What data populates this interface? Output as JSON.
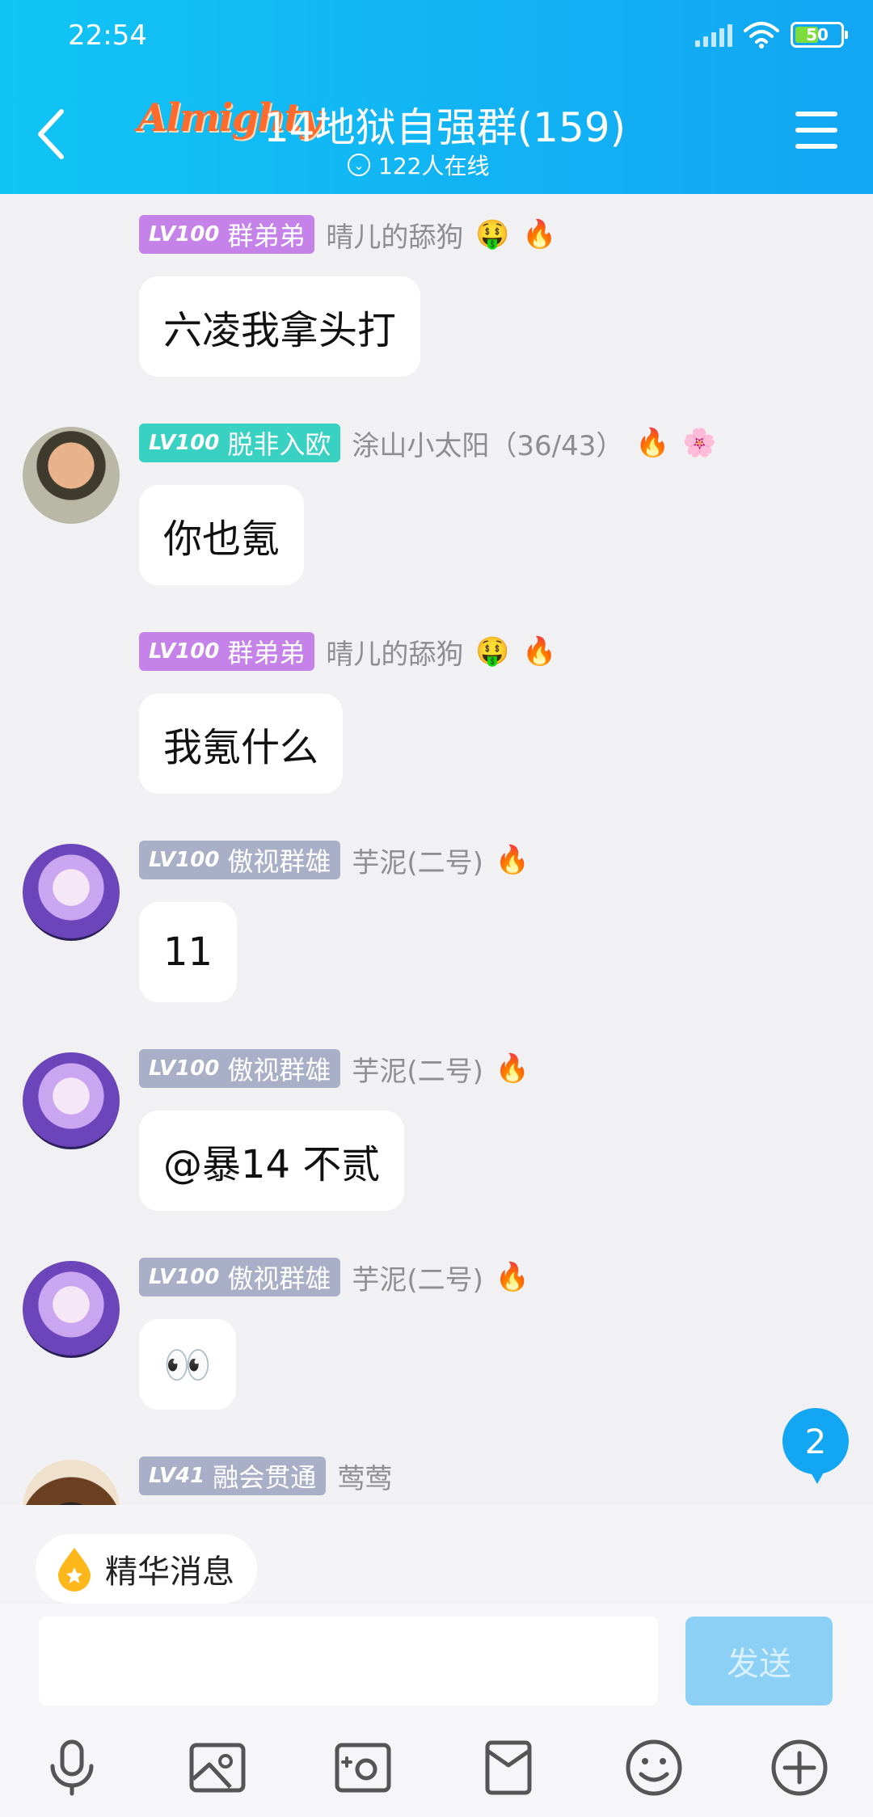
{
  "status_bar": {
    "time": "22:54",
    "battery": "50"
  },
  "header": {
    "logo_text": "Almighty",
    "title": "14地狱自强群(159)",
    "online": "122人在线"
  },
  "messages": [
    {
      "badge_level": "LV100",
      "badge_title": "群弟弟",
      "badge_color": "#c583ea",
      "sender": "晴儿的舔狗",
      "text": "六凌我拿头打",
      "has_avatar": false
    },
    {
      "badge_level": "LV100",
      "badge_title": "脱非入欧",
      "badge_color": "#38d1c2",
      "sender": "涂山小太阳（36/43）",
      "text": "你也氪",
      "has_avatar": true
    },
    {
      "badge_level": "LV100",
      "badge_title": "群弟弟",
      "badge_color": "#c583ea",
      "sender": "晴儿的舔狗",
      "text": "我氪什么",
      "has_avatar": false
    },
    {
      "badge_level": "LV100",
      "badge_title": "傲视群雄",
      "badge_color": "#a9afc7",
      "sender": "芋泥(二号)",
      "text": "11",
      "has_avatar": true
    },
    {
      "badge_level": "LV100",
      "badge_title": "傲视群雄",
      "badge_color": "#a9afc7",
      "sender": "芋泥(二号)",
      "text": "@暴14   不贰",
      "has_avatar": true
    },
    {
      "badge_level": "LV100",
      "badge_title": "傲视群雄",
      "badge_color": "#a9afc7",
      "sender": "芋泥(二号)",
      "text": "👀",
      "has_avatar": true
    },
    {
      "badge_level": "LV41",
      "badge_title": "融会贯通",
      "badge_color": "#a9afc7",
      "sender": "莺莺",
      "text": "",
      "has_avatar": true
    }
  ],
  "unread_count": "2",
  "essence_label": "精华消息",
  "input": {
    "value": "",
    "send_label": "发送"
  },
  "toolbar_icons": [
    "microphone-icon",
    "image-icon",
    "camera-icon",
    "red-packet-icon",
    "emoji-icon",
    "plus-icon"
  ]
}
